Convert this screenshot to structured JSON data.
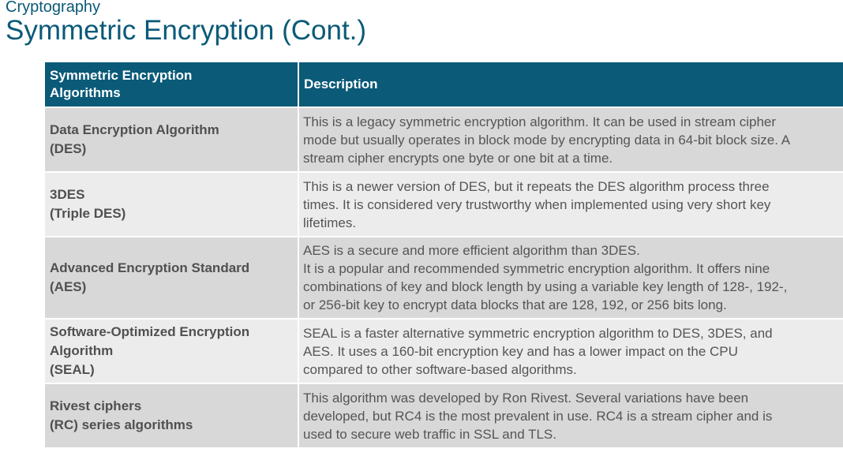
{
  "header": {
    "kicker": "Cryptography",
    "title": "Symmetric Encryption (Cont.)"
  },
  "table": {
    "headers": {
      "col1": [
        "Symmetric Encryption",
        "Algorithms"
      ],
      "col2": "Description"
    },
    "rows": [
      {
        "name": [
          "Data Encryption Algorithm",
          "(DES)"
        ],
        "description": [
          "This is a legacy symmetric encryption algorithm. It can be used in stream cipher",
          "mode but usually operates in block mode by encrypting data in 64-bit block size. A",
          "stream cipher encrypts one byte or one bit at a time."
        ]
      },
      {
        "name": [
          "3DES",
          "(Triple DES)"
        ],
        "description": [
          "This is a newer version of DES, but it repeats the DES algorithm process three",
          "times. It is considered very trustworthy when implemented using very short key",
          "lifetimes."
        ]
      },
      {
        "name": [
          "Advanced Encryption Standard",
          "(AES)"
        ],
        "description": [
          "AES is a secure and more efficient algorithm than 3DES.",
          "It is a popular and recommended symmetric encryption algorithm. It offers nine",
          "combinations of key and block length by using a variable key length of 128-, 192-,",
          "or 256-bit key to encrypt data blocks that are 128, 192, or 256 bits long."
        ]
      },
      {
        "name": [
          "Software-Optimized Encryption",
          "Algorithm",
          "(SEAL)"
        ],
        "description": [
          "SEAL is a faster alternative symmetric encryption algorithm to DES, 3DES, and",
          "AES. It uses a 160-bit encryption key and has a lower impact on the CPU",
          "compared to other software-based algorithms."
        ]
      },
      {
        "name": [
          "Rivest ciphers",
          "(RC) series algorithms"
        ],
        "description": [
          "This algorithm was developed by Ron Rivest. Several variations have been",
          "developed, but RC4 is the most prevalent in use. RC4 is a stream cipher and is",
          "used to secure web traffic in SSL and TLS."
        ]
      }
    ]
  },
  "colors": {
    "header_bg": "#0a5a78",
    "title_color": "#0a5a78",
    "row_odd_bg": "#d8d8d8",
    "row_even_bg": "#ececec"
  }
}
